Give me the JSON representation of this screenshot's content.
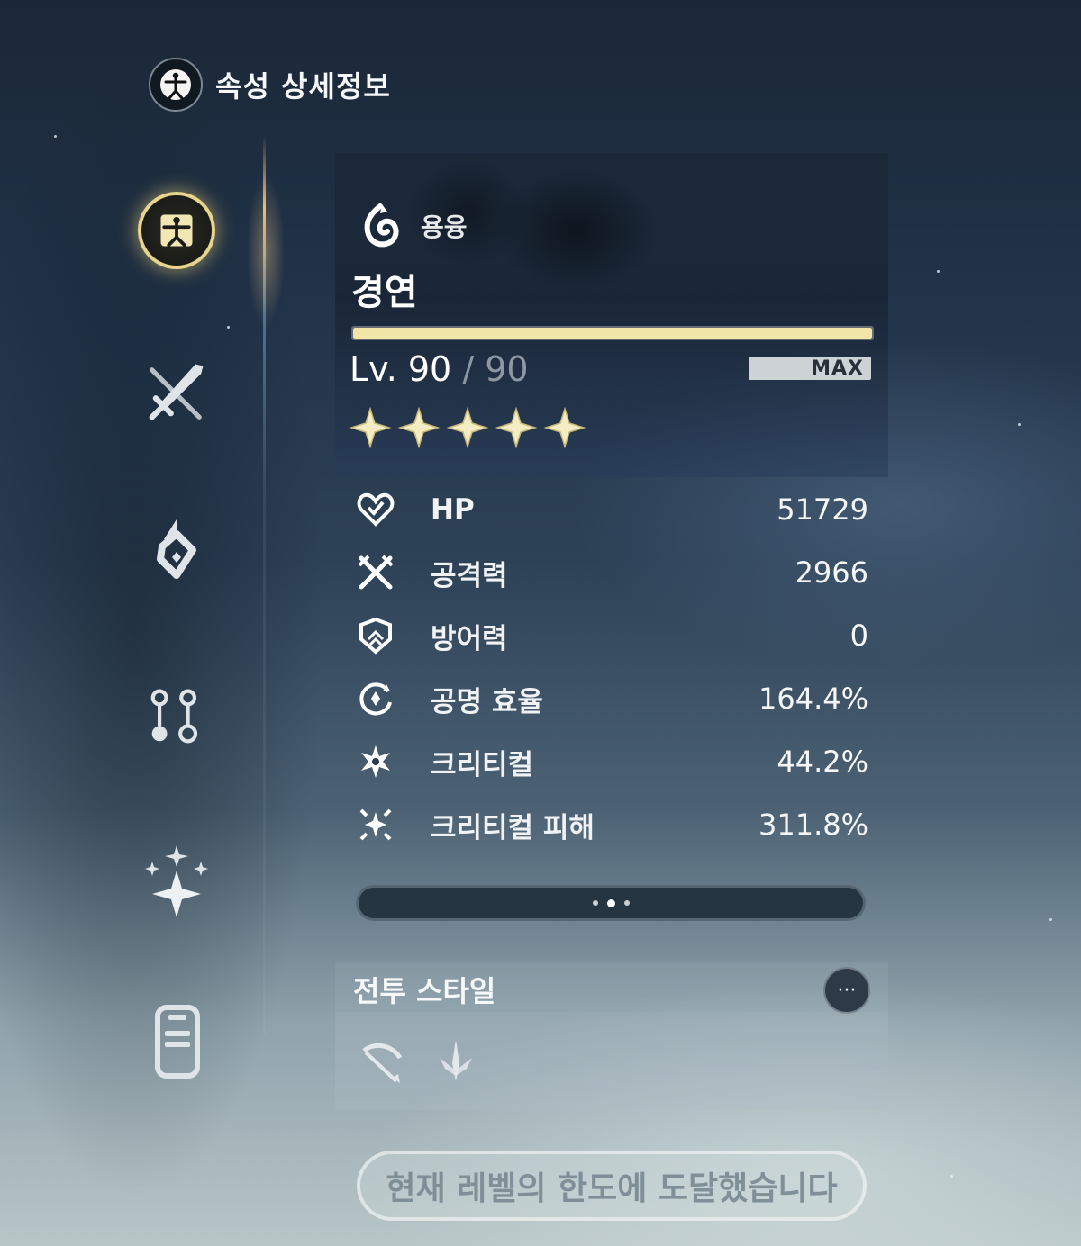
{
  "header": {
    "title": "속성 상세정보",
    "icon": "vitruvian-icon"
  },
  "sidebar": {
    "items": [
      {
        "name": "attributes",
        "icon": "vitruvian-icon",
        "active": true
      },
      {
        "name": "weapon",
        "icon": "sword-icon",
        "active": false
      },
      {
        "name": "echo",
        "icon": "echo-icon",
        "active": false
      },
      {
        "name": "forte",
        "icon": "nodes-icon",
        "active": false
      },
      {
        "name": "resonance-chain",
        "icon": "sparkle-cluster-icon",
        "active": false
      },
      {
        "name": "profile",
        "icon": "card-icon",
        "active": false
      }
    ]
  },
  "character": {
    "element": "용융",
    "element_icon": "fusion-icon",
    "name": "경연",
    "level": "Lv. 90",
    "separator": " / ",
    "max_level": "90",
    "max_badge": "MAX",
    "rarity": 5,
    "xp_progress": 1.0
  },
  "stats": [
    {
      "icon": "heart-icon",
      "label": "HP",
      "value": "51729"
    },
    {
      "icon": "crossed-swords-icon",
      "label": "공격력",
      "value": "2966"
    },
    {
      "icon": "shield-icon",
      "label": "방어력",
      "value": "0"
    },
    {
      "icon": "resonance-icon",
      "label": "공명 효율",
      "value": "164.4%"
    },
    {
      "icon": "crit-icon",
      "label": "크리티컬",
      "value": "44.2%"
    },
    {
      "icon": "crit-damage-icon",
      "label": "크리티컬 피해",
      "value": "311.8%"
    }
  ],
  "combat_style": {
    "title": "전투 스타일",
    "more": "···",
    "icons": [
      "bow-icon",
      "blade-icon"
    ]
  },
  "footer": {
    "limit_text": "현재 레벨의 한도에 도달했습니다"
  },
  "colors": {
    "accent_gold": "#e9d48e",
    "xp_fill": "#f1e5a8"
  }
}
